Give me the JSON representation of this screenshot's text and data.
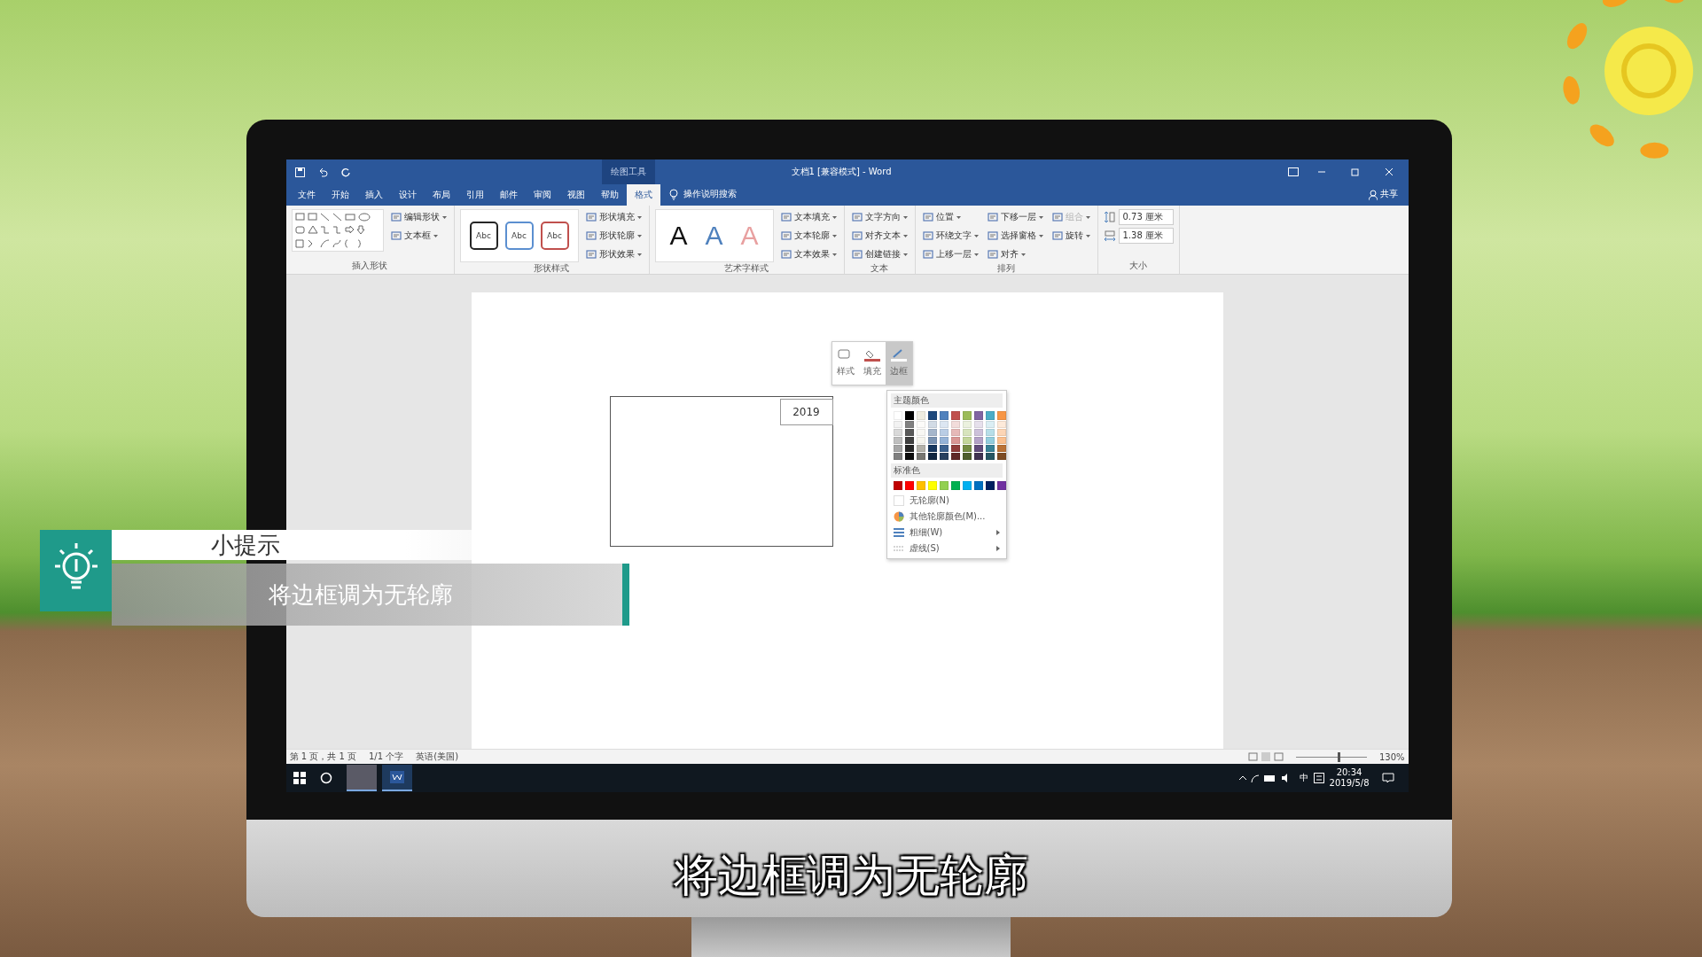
{
  "word": {
    "title_bar": {
      "context_label": "绘图工具",
      "title": "文档1 [兼容模式] - Word"
    },
    "tabs": [
      {
        "label": "文件",
        "selected": false
      },
      {
        "label": "开始",
        "selected": false
      },
      {
        "label": "插入",
        "selected": false
      },
      {
        "label": "设计",
        "selected": false
      },
      {
        "label": "布局",
        "selected": false
      },
      {
        "label": "引用",
        "selected": false
      },
      {
        "label": "邮件",
        "selected": false
      },
      {
        "label": "审阅",
        "selected": false
      },
      {
        "label": "视图",
        "selected": false
      },
      {
        "label": "帮助",
        "selected": false
      },
      {
        "label": "格式",
        "selected": true
      }
    ],
    "tell_me": "操作说明搜索",
    "share": "共享",
    "ribbon": {
      "insert_shapes": {
        "buttons": [
          "编辑形状",
          "文本框"
        ],
        "label": "插入形状"
      },
      "shape_styles": {
        "presets": [
          {
            "text": "Abc",
            "color": "#262626"
          },
          {
            "text": "Abc",
            "color": "#5b8fd0"
          },
          {
            "text": "Abc",
            "color": "#c0504d"
          }
        ],
        "buttons": [
          "形状填充",
          "形状轮廓",
          "形状效果"
        ],
        "label": "形状样式"
      },
      "wordart_styles": {
        "presets": [
          {
            "text": "A",
            "color": "#111111"
          },
          {
            "text": "A",
            "color": "#4f81bd"
          },
          {
            "text": "A",
            "color": "#e8a0a0"
          }
        ],
        "buttons": [
          "文本填充",
          "文本轮廓",
          "文本效果"
        ],
        "label": "艺术字样式"
      },
      "text": {
        "buttons": [
          "文字方向",
          "对齐文本",
          "创建链接"
        ],
        "label": "文本"
      },
      "arrange": {
        "buttons": [
          {
            "label": "位置",
            "disabled": false
          },
          {
            "label": "环绕文字",
            "disabled": false
          },
          {
            "label": "上移一层",
            "disabled": false
          },
          {
            "label": "下移一层",
            "disabled": false
          },
          {
            "label": "选择窗格",
            "disabled": false
          },
          {
            "label": "对齐",
            "disabled": false
          },
          {
            "label": "组合",
            "disabled": true
          },
          {
            "label": "旋转",
            "disabled": false
          }
        ],
        "label": "排列"
      },
      "size": {
        "fields": [
          {
            "kind": "height",
            "value": "0.73 厘米"
          },
          {
            "kind": "width",
            "value": "1.38 厘米"
          }
        ],
        "label": "大小"
      }
    },
    "document": {
      "textbox": "2019",
      "mini_toolbar": [
        {
          "label": "样式",
          "selected": false
        },
        {
          "label": "填充",
          "selected": false
        },
        {
          "label": "边框",
          "selected": true
        }
      ],
      "outline_menu": {
        "theme_heading": "主题颜色",
        "theme_colors": [
          {
            "color": "#ffffff"
          },
          {
            "color": "#000000"
          },
          {
            "color": "#eeece1"
          },
          {
            "color": "#1f497d"
          },
          {
            "color": "#4f81bd"
          },
          {
            "color": "#c0504d"
          },
          {
            "color": "#9bbb59"
          },
          {
            "color": "#8064a2"
          },
          {
            "color": "#4bacc6"
          },
          {
            "color": "#f79646"
          }
        ],
        "standard_heading": "标准色",
        "standard_colors": [
          {
            "color": "#c00000"
          },
          {
            "color": "#ff0000"
          },
          {
            "color": "#ffc000"
          },
          {
            "color": "#ffff00"
          },
          {
            "color": "#92d050"
          },
          {
            "color": "#00b050"
          },
          {
            "color": "#00b0f0"
          },
          {
            "color": "#0070c0"
          },
          {
            "color": "#002060"
          },
          {
            "color": "#7030a0"
          }
        ],
        "items": [
          {
            "kind": "none",
            "label": "无轮廓(N)",
            "submenu": false
          },
          {
            "kind": "wheel",
            "label": "其他轮廓颜色(M)...",
            "submenu": false
          },
          {
            "kind": "weight",
            "label": "粗细(W)",
            "submenu": true
          },
          {
            "kind": "dash",
            "label": "虚线(S)",
            "submenu": true
          }
        ]
      }
    },
    "status_bar": {
      "items": [
        "第 1 页，共 1 页",
        "1/1 个字",
        "英语(美国)"
      ],
      "zoom": "130%",
      "level": 0.6
    },
    "taskbar": {
      "ime": "中",
      "time": "20:34",
      "date": "2019/5/8"
    }
  },
  "tip": {
    "title": "小提示",
    "text": "将边框调为无轮廓"
  },
  "subtitle": "将边框调为无轮廓"
}
